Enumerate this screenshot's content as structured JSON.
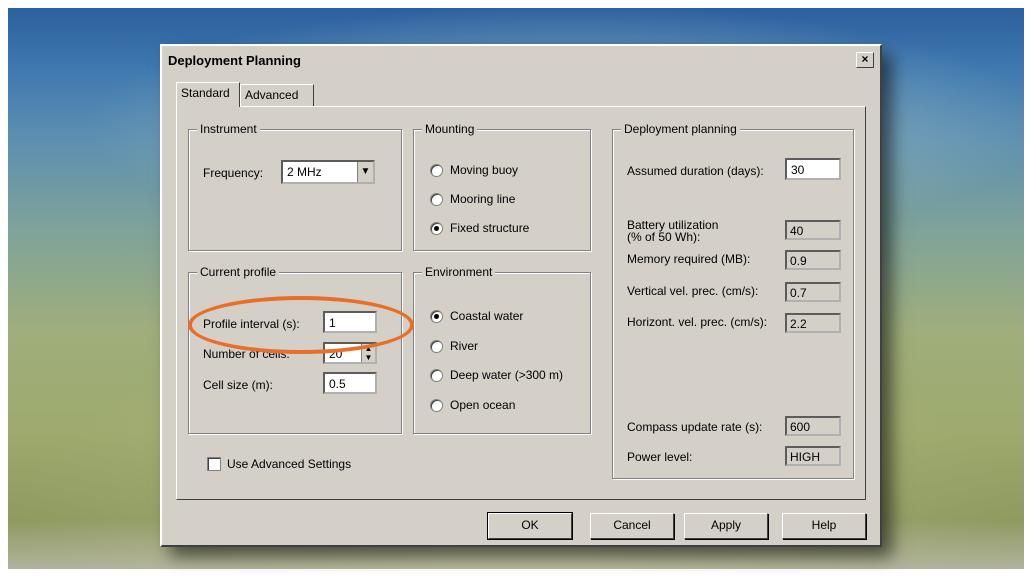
{
  "dialog": {
    "title": "Deployment Planning",
    "close_glyph": "×"
  },
  "tabs": [
    {
      "label": "Standard",
      "active": true
    },
    {
      "label": "Advanced",
      "active": false
    }
  ],
  "instrument": {
    "group_label": "Instrument",
    "frequency_label": "Frequency:",
    "frequency_value": "2 MHz"
  },
  "mounting": {
    "group_label": "Mounting",
    "options": [
      {
        "label": "Moving buoy",
        "selected": false
      },
      {
        "label": "Mooring line",
        "selected": false
      },
      {
        "label": "Fixed structure",
        "selected": true
      }
    ]
  },
  "current_profile": {
    "group_label": "Current profile",
    "profile_interval_label": "Profile interval (s):",
    "profile_interval_value": "1",
    "num_cells_label": "Number of cells:",
    "num_cells_value": "20",
    "cell_size_label": "Cell size (m):",
    "cell_size_value": "0.5"
  },
  "environment": {
    "group_label": "Environment",
    "options": [
      {
        "label": "Coastal water",
        "selected": true
      },
      {
        "label": "River",
        "selected": false
      },
      {
        "label": "Deep water (>300 m)",
        "selected": false
      },
      {
        "label": "Open ocean",
        "selected": false
      }
    ]
  },
  "deployment": {
    "group_label": "Deployment planning",
    "duration_label": "Assumed duration (days):",
    "duration_value": "30",
    "battery_label_1": "Battery utilization",
    "battery_label_2": "(% of 50 Wh):",
    "battery_value": "40",
    "memory_label": "Memory required (MB):",
    "memory_value": "0.9",
    "vertical_label": "Vertical vel. prec. (cm/s):",
    "vertical_value": "0.7",
    "horizontal_label": "Horizont. vel. prec. (cm/s):",
    "horizontal_value": "2.2",
    "compass_label": "Compass update rate (s):",
    "compass_value": "600",
    "power_label": "Power level:",
    "power_value": "HIGH"
  },
  "advanced_checkbox": {
    "label": "Use Advanced Settings",
    "checked": false
  },
  "buttons": {
    "ok": "OK",
    "cancel": "Cancel",
    "apply": "Apply",
    "help": "Help"
  },
  "colors": {
    "highlight": "#e86f2a",
    "dialog_bg": "#d4d0c8"
  }
}
